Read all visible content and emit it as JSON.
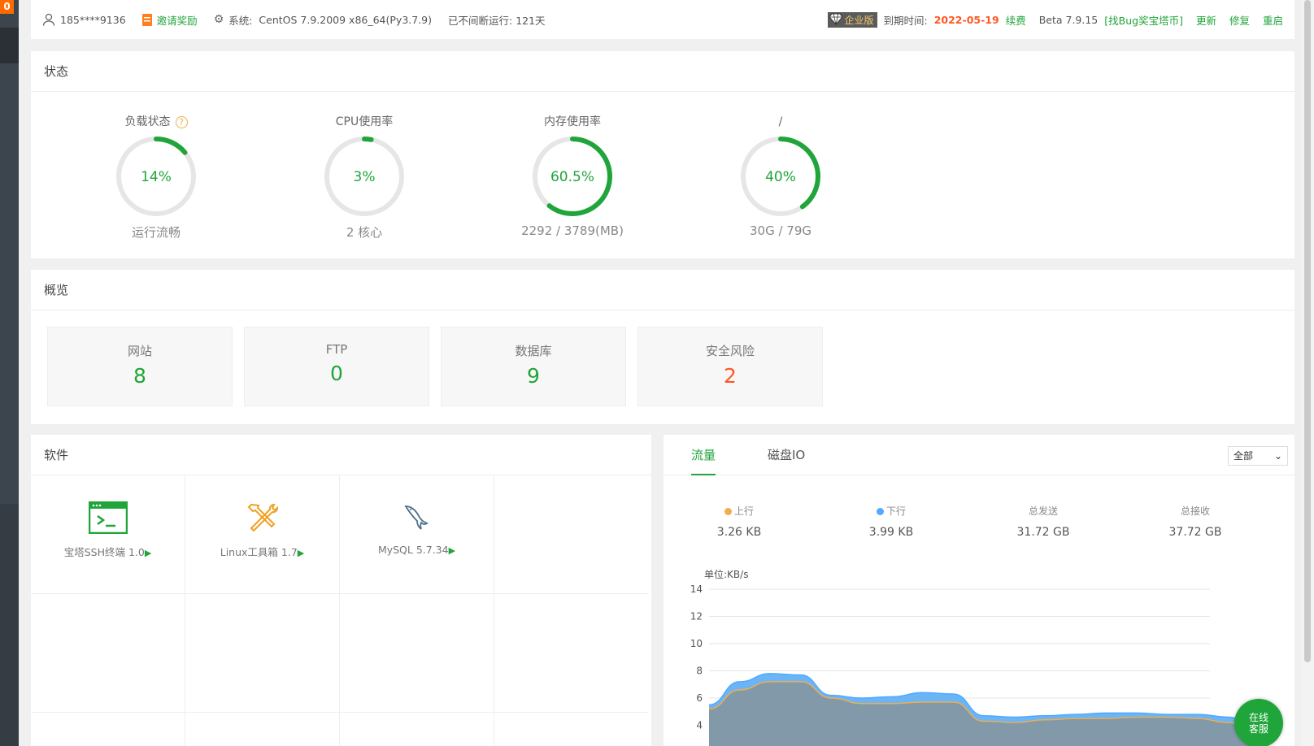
{
  "sidebar": {
    "badge": "0"
  },
  "topbar": {
    "user": "185****9136",
    "invite": "邀请奖励",
    "system_label": "系统:",
    "system_value": "CentOS 7.9.2009 x86_64(Py3.7.9)",
    "uptime": "已不间断运行: 121天",
    "edition": "企业版",
    "expire_label": "到期时间:",
    "expire_date": "2022-05-19",
    "renew": "续费",
    "version": "Beta 7.9.15",
    "bug_bounty": "[找Bug奖宝塔币]",
    "update": "更新",
    "repair": "修复",
    "restart": "重启"
  },
  "status": {
    "title": "状态",
    "gauges": [
      {
        "label": "负载状态",
        "value": "14%",
        "percent": 14,
        "sub": "运行流畅",
        "help": "?"
      },
      {
        "label": "CPU使用率",
        "value": "3%",
        "percent": 3,
        "sub": "2 核心"
      },
      {
        "label": "内存使用率",
        "value": "60.5%",
        "percent": 60.5,
        "sub": "2292 / 3789(MB)"
      },
      {
        "label": "/",
        "value": "40%",
        "percent": 40,
        "sub": "30G / 79G"
      }
    ]
  },
  "overview": {
    "title": "概览",
    "cards": [
      {
        "label": "网站",
        "value": "8"
      },
      {
        "label": "FTP",
        "value": "0"
      },
      {
        "label": "数据库",
        "value": "9"
      },
      {
        "label": "安全风险",
        "value": "2"
      }
    ]
  },
  "software": {
    "title": "软件",
    "items": [
      {
        "name": "宝塔SSH终端 1.0",
        "icon": "terminal-icon"
      },
      {
        "name": "Linux工具箱 1.7",
        "icon": "toolbox-icon"
      },
      {
        "name": "MySQL 5.7.34",
        "icon": "mysql-dolphin-icon"
      }
    ]
  },
  "traffic": {
    "tabs": [
      "流量",
      "磁盘IO"
    ],
    "select": "全部",
    "stats": [
      {
        "label": "上行",
        "value": "3.26 KB",
        "color": "#f0ad4e"
      },
      {
        "label": "下行",
        "value": "3.99 KB",
        "color": "#52a9ff"
      },
      {
        "label": "总发送",
        "value": "31.72 GB"
      },
      {
        "label": "总接收",
        "value": "37.72 GB"
      }
    ],
    "unit": "单位:KB/s"
  },
  "chart_data": {
    "type": "area",
    "ylabel": "单位:KB/s",
    "ylim": [
      0,
      14
    ],
    "yticks": [
      "14",
      "12",
      "10",
      "8",
      "6",
      "4"
    ],
    "x": [
      0,
      1,
      2,
      3,
      4,
      5,
      6,
      7,
      8,
      9,
      10,
      11,
      12,
      13,
      14,
      15,
      16,
      17,
      18
    ],
    "series": [
      {
        "name": "下行",
        "color": "#52a9ff",
        "values": [
          5.5,
          7.2,
          7.8,
          7.7,
          6.2,
          6.0,
          6.1,
          6.4,
          6.3,
          4.7,
          4.6,
          4.7,
          4.8,
          4.9,
          4.9,
          4.8,
          4.8,
          4.6,
          3.8
        ]
      },
      {
        "name": "上行",
        "color": "#f0ad4e",
        "values": [
          5.2,
          6.6,
          7.2,
          7.2,
          6.0,
          5.6,
          5.6,
          5.7,
          5.7,
          4.3,
          4.2,
          4.4,
          4.5,
          4.5,
          4.6,
          4.6,
          4.5,
          4.2,
          3.5
        ]
      }
    ]
  },
  "chat": {
    "line1": "在线",
    "line2": "客服"
  }
}
